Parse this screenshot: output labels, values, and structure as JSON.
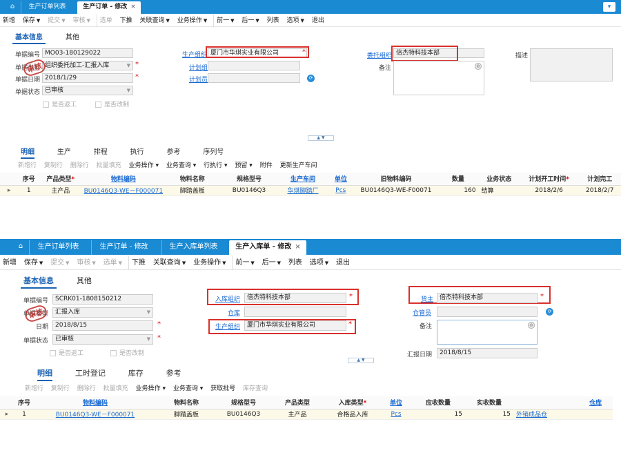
{
  "top": {
    "tabs": {
      "list": "生产订单列表",
      "active": "生产订单 - 修改"
    },
    "toolbar": {
      "new": "新增",
      "save": "保存",
      "submit": "提交",
      "audit": "审核",
      "choose": "选单",
      "push": "下推",
      "linkquery": "关联查询",
      "bizop": "业务操作",
      "prev": "前一",
      "next": "后一",
      "list": "列表",
      "options": "选项",
      "exit": "退出"
    },
    "subtabs": {
      "basic": "基本信息",
      "other": "其他"
    },
    "fields": {
      "bill_no_label": "单据编号",
      "bill_no": "MO03-180129022",
      "bill_type_label": "单据类型",
      "bill_type": "组织委托加工-汇报入库",
      "bill_date_label": "单据日期",
      "bill_date": "2018/1/29",
      "bill_status_label": "单据状态",
      "bill_status": "已审核",
      "prod_org_label": "生产组织",
      "prod_org": "厦门市华琪实业有限公司",
      "plan_group_label": "计划组",
      "planner_label": "计划员",
      "entrust_org_label": "委托组织",
      "entrust_org": "倍杰特科技本部",
      "remark_label": "备注",
      "desc_label": "描述",
      "is_rework": "是否返工",
      "is_modified": "是否改制",
      "stamp": "审核"
    },
    "detail_tabs": [
      "明细",
      "生产",
      "排程",
      "执行",
      "参考",
      "序列号"
    ],
    "gridbar": {
      "addrow": "新增行",
      "copyrow": "复制行",
      "delrow": "删除行",
      "batchfill": "批量填充",
      "bizop": "业务操作",
      "bizquery": "业务查询",
      "rowexec": "行执行",
      "alert": "预留",
      "attach": "附件",
      "update": "更新生产车间"
    },
    "columns": [
      "序号",
      "产品类型",
      "物料编码",
      "物料名称",
      "规格型号",
      "生产车间",
      "单位",
      "旧物料编码",
      "数量",
      "业务状态",
      "计划开工时间",
      "计划完工"
    ],
    "row": {
      "seq": "1",
      "ptype": "主产品",
      "code": "BU0146Q3-WE－F000071",
      "name": "脚踏盖板",
      "spec": "BU0146Q3",
      "workshop": "华琪脚踏厂",
      "unit": "Pcs",
      "oldcode": "BU0146Q3-WE-F00071",
      "qty": "160",
      "status": "结算",
      "start": "2018/2/6",
      "end": "2018/2/7"
    }
  },
  "bottom": {
    "tabs": {
      "t1": "生产订单列表",
      "t2": "生产订单 - 修改",
      "t3": "生产入库单列表",
      "active": "生产入库单 - 修改"
    },
    "toolbar": {
      "new": "新增",
      "save": "保存",
      "submit": "提交",
      "audit": "审核",
      "choose": "选单",
      "push": "下推",
      "linkquery": "关联查询",
      "bizop": "业务操作",
      "prev": "前一",
      "next": "后一",
      "list": "列表",
      "options": "选项",
      "exit": "退出"
    },
    "subtabs": {
      "basic": "基本信息",
      "other": "其他"
    },
    "fields": {
      "bill_no_label": "单据编号",
      "bill_no": "SCRK01-1808150212",
      "bill_type_label": "单据类型",
      "bill_type": "汇报入库",
      "date_label": "日期",
      "date": "2018/8/15",
      "bill_status_label": "单据状态",
      "bill_status": "已审核",
      "in_org_label": "入库组织",
      "in_org": "倍杰特科技本部",
      "warehouse_label": "仓库",
      "prod_org_label": "生产组织",
      "prod_org": "厦门市华琪实业有限公司",
      "owner_label": "货主",
      "owner": "倍杰特科技本部",
      "keeper_label": "仓管员",
      "remark_label": "备注",
      "report_date_label": "汇报日期",
      "report_date": "2018/8/15",
      "is_rework": "是否返工",
      "is_modified": "是否改制",
      "stamp": "审核"
    },
    "detail_tabs": [
      "明细",
      "工时登记",
      "库存",
      "参考"
    ],
    "gridbar": {
      "addrow": "新增行",
      "copyrow": "复制行",
      "delrow": "删除行",
      "batchfill": "批量填充",
      "bizop": "业务操作",
      "bizquery": "业务查询",
      "getlot": "获取批号",
      "stockquery": "库存查询"
    },
    "columns": [
      "序号",
      "物料编码",
      "物料名称",
      "规格型号",
      "产品类型",
      "入库类型",
      "单位",
      "应收数量",
      "实收数量",
      "仓库"
    ],
    "row": {
      "seq": "1",
      "code": "BU0146Q3-WE－F000071",
      "name": "脚踏盖板",
      "spec": "BU0146Q3",
      "ptype": "主产品",
      "intype": "合格品入库",
      "unit": "Pcs",
      "due": "15",
      "actual": "15",
      "warehouse": "外销成品仓"
    }
  }
}
